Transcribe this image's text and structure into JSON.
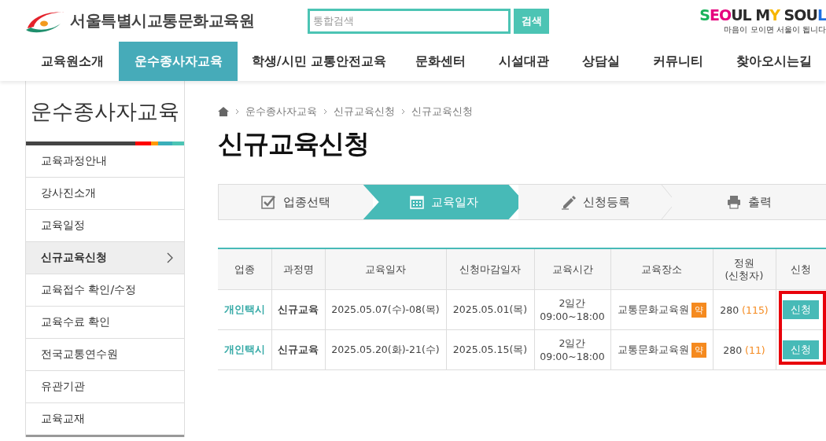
{
  "header": {
    "logo_text": "서울특별시교통문화교육원",
    "search": {
      "placeholder": "통합검색",
      "button": "검색"
    },
    "slogan": {
      "text": "SEOUL MY SOUL",
      "tagline": "마음이 모이면 서울이 됩니다"
    }
  },
  "nav": [
    {
      "label": "교육원소개",
      "selected": false
    },
    {
      "label": "운수종사자교육",
      "selected": true
    },
    {
      "label": "학생/시민 교통안전교육",
      "selected": false
    },
    {
      "label": "문화센터",
      "selected": false
    },
    {
      "label": "시설대관",
      "selected": false
    },
    {
      "label": "상담실",
      "selected": false
    },
    {
      "label": "커뮤니티",
      "selected": false
    },
    {
      "label": "찾아오시는길",
      "selected": false
    }
  ],
  "sidebar": {
    "title": "운수종사자교육",
    "items": [
      {
        "label": "교육과정안내",
        "selected": false
      },
      {
        "label": "강사진소개",
        "selected": false
      },
      {
        "label": "교육일정",
        "selected": false
      },
      {
        "label": "신규교육신청",
        "selected": true
      },
      {
        "label": "교육접수 확인/수정",
        "selected": false
      },
      {
        "label": "교육수료 확인",
        "selected": false
      },
      {
        "label": "전국교통연수원",
        "selected": false
      },
      {
        "label": "유관기관",
        "selected": false
      },
      {
        "label": "교육교재",
        "selected": false
      }
    ]
  },
  "breadcrumb": [
    "운수종사자교육",
    "신규교육신청",
    "신규교육신청"
  ],
  "page_title": "신규교육신청",
  "steps": [
    {
      "label": "업종선택",
      "selected": false
    },
    {
      "label": "교육일자",
      "selected": true
    },
    {
      "label": "신청등록",
      "selected": false
    },
    {
      "label": "출력",
      "selected": false
    }
  ],
  "table": {
    "columns": [
      "업종",
      "과정명",
      "교육일자",
      "신청마감일자",
      "교육시간",
      "교육장소",
      "정원\n(신청자)",
      "신청"
    ],
    "apply_column_highlighted": true,
    "rows": [
      {
        "category": "개인택시",
        "course": "신규교육",
        "dates": "2025.05.07(수)-08(목)",
        "deadline": "2025.05.01(목)",
        "duration": "2일간",
        "hours": "09:00~18:00",
        "place": "교통문화교육원",
        "map_badge": "약",
        "capacity": "280",
        "applicants": "(115)",
        "apply": "신청"
      },
      {
        "category": "개인택시",
        "course": "신규교육",
        "dates": "2025.05.20(화)-21(수)",
        "deadline": "2025.05.15(목)",
        "duration": "2일간",
        "hours": "09:00~18:00",
        "place": "교통문화교육원",
        "map_badge": "약",
        "capacity": "280",
        "applicants": "(11)",
        "apply": "신청"
      }
    ]
  }
}
